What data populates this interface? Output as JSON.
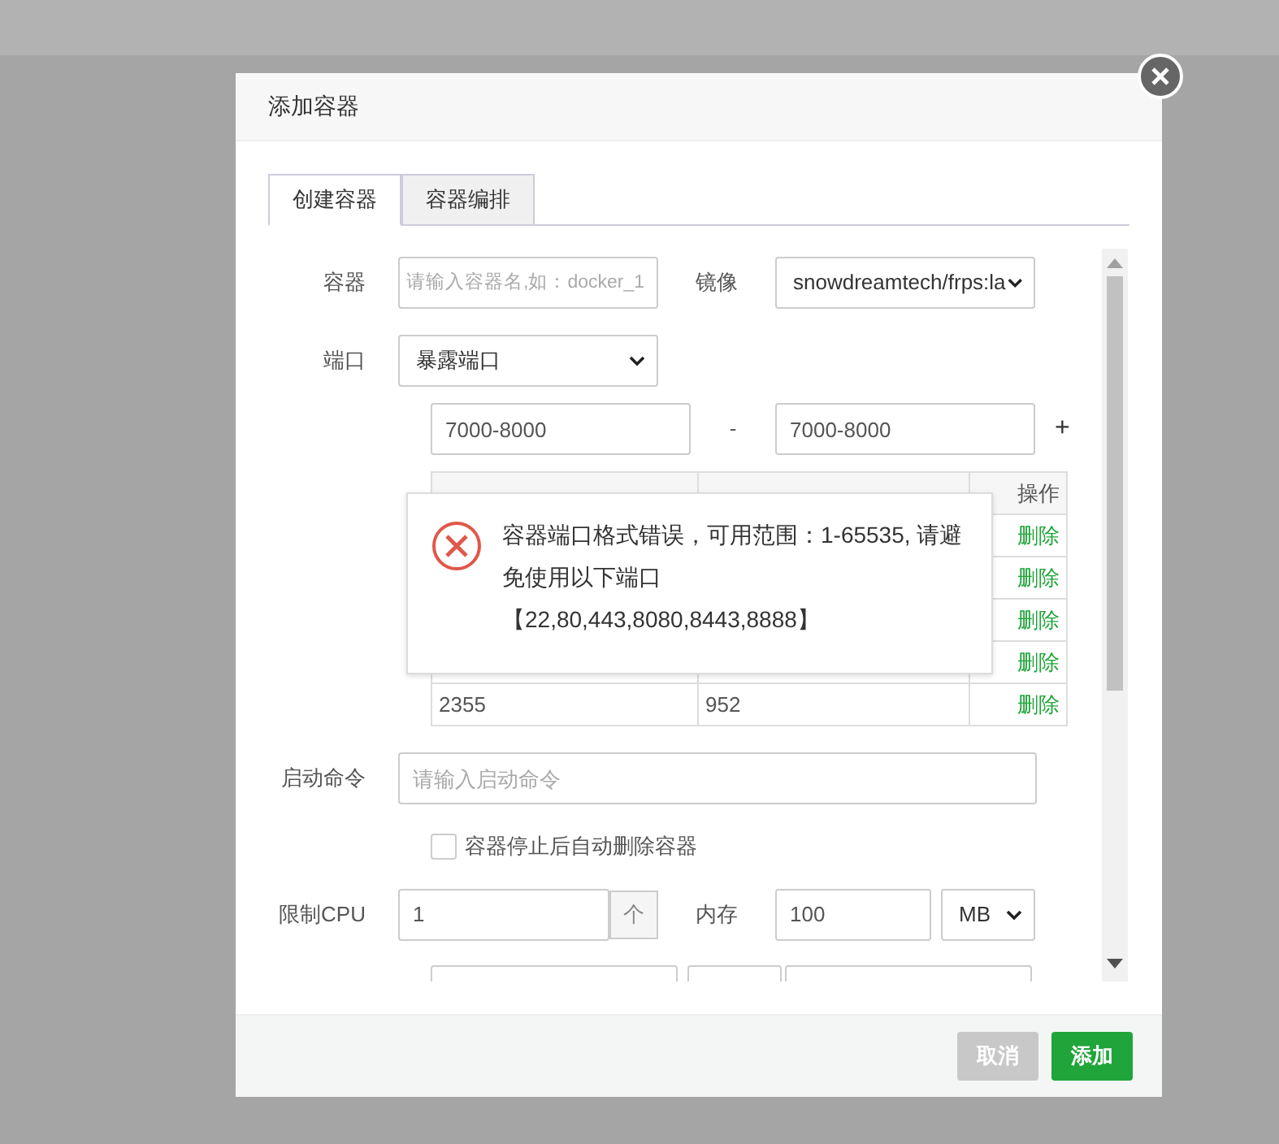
{
  "dialog": {
    "title": "添加容器",
    "tabs": [
      {
        "label": "创建容器",
        "selected": true
      },
      {
        "label": "容器编排",
        "selected": false
      }
    ],
    "container": {
      "label": "容器",
      "placeholder": "请输入容器名,如：docker_1"
    },
    "image": {
      "label": "镜像",
      "value": "snowdreamtech/frps:la"
    },
    "port": {
      "label": "端口",
      "value": "暴露端口",
      "range_from": "7000-8000",
      "separator": "-",
      "range_to": "7000-8000",
      "add": "+"
    },
    "port_table": {
      "action_header": "操作",
      "rows": [
        {
          "action": "删除"
        },
        {
          "action": "删除"
        },
        {
          "action": "删除"
        },
        {
          "action": "删除"
        },
        {
          "container_port": "2355",
          "server_port": "952",
          "action": "删除"
        }
      ]
    },
    "command": {
      "label": "启动命令",
      "placeholder": "请输入启动命令"
    },
    "auto_remove": {
      "label": "容器停止后自动删除容器",
      "checked": false
    },
    "cpu": {
      "label": "限制CPU",
      "value": "1",
      "step": "个"
    },
    "memory": {
      "label": "内存",
      "value": "100",
      "unit": "MB"
    },
    "toast": {
      "message": "容器端口格式错误，可用范围：1-65535, 请避免使用以下端口【22,80,443,8080,8443,8888】"
    },
    "buttons": [
      {
        "label": "取消",
        "kind": "cancel"
      },
      {
        "label": "添加",
        "kind": "primary"
      }
    ]
  }
}
